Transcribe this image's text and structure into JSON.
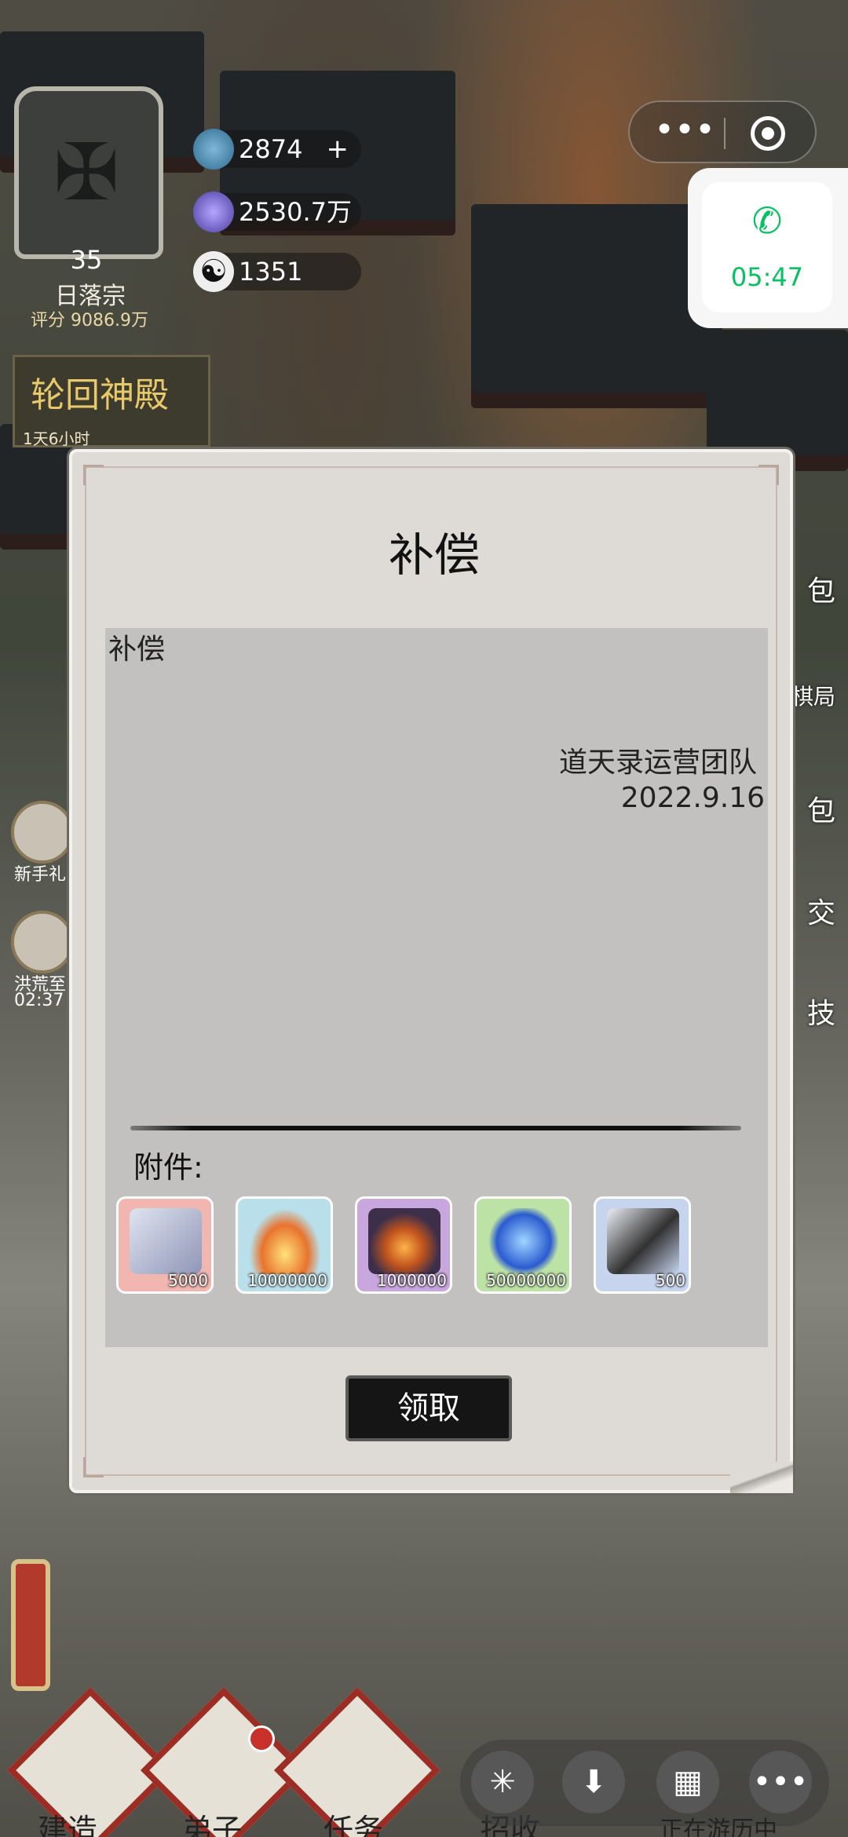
{
  "hud": {
    "level": "35",
    "sect_name": "日落宗",
    "score": "评分 9086.9万",
    "resources": [
      {
        "icon": "spirit-stone-icon",
        "value": "2874",
        "has_plus": true
      },
      {
        "icon": "crystal-icon",
        "value": "2530.7万"
      },
      {
        "icon": "yin-yang-icon",
        "value": "1351"
      }
    ]
  },
  "event_banner": {
    "title": "轮回神殿",
    "time": "1天6小时"
  },
  "mini_program": {
    "call_time": "05:47"
  },
  "side_left": [
    {
      "label": "新手礼"
    },
    {
      "label": "洪荒至宝",
      "timer": "02:37"
    }
  ],
  "side_right": [
    "包",
    "棋局",
    "包",
    "交",
    "技"
  ],
  "dialog": {
    "title": "补偿",
    "mail_subject": "补偿",
    "sender": "道天录运营团队",
    "date": "2022.9.16",
    "attachments_label": "附件:",
    "attachments": [
      {
        "icon": "jigsaw-dragon-icon",
        "qty": "5000",
        "bg": "#f2b6b0"
      },
      {
        "icon": "golden-sand-icon",
        "qty": "10000000",
        "bg": "#b9e0ea"
      },
      {
        "icon": "flame-ore-icon",
        "qty": "1000000",
        "bg": "#c8a6de"
      },
      {
        "icon": "blue-gem-icon",
        "qty": "50000000",
        "bg": "#bde2a6"
      },
      {
        "icon": "jigsaw-portrait-icon",
        "qty": "500",
        "bg": "#c7d4ee"
      }
    ],
    "claim_label": "领取"
  },
  "bottom_nav": [
    {
      "label": "建造"
    },
    {
      "label": "弟子",
      "badge": true
    },
    {
      "label": "任务"
    },
    {
      "label": "招收"
    }
  ],
  "traveling_label": "正在游历中",
  "colors": {
    "accent_green": "#07c160",
    "nav_red": "#9c2d24"
  }
}
